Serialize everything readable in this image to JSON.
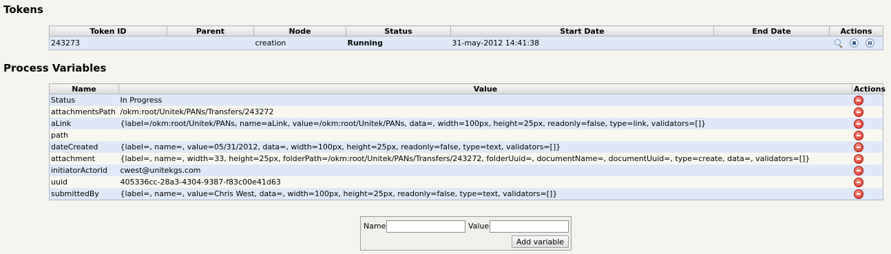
{
  "tokens": {
    "title": "Tokens",
    "columns": [
      "Token ID",
      "Parent",
      "Node",
      "Status",
      "Start Date",
      "End Date",
      "Actions"
    ],
    "rows": [
      {
        "token_id": "243273",
        "parent": "",
        "node": "creation",
        "status": "Running",
        "start_date": "31-may-2012 14:41:38",
        "end_date": "",
        "actions": [
          "view-icon",
          "stop-icon",
          "pause-icon"
        ]
      }
    ]
  },
  "variables": {
    "title": "Process Variables",
    "columns": [
      "Name",
      "Value",
      "Actions"
    ],
    "rows": [
      {
        "name": "Status",
        "value": "In Progress"
      },
      {
        "name": "attachmentsPath",
        "value": "/okm:root/Unitek/PANs/Transfers/243272"
      },
      {
        "name": "aLink",
        "value": "{label=/okm:root/Unitek/PANs, name=aLink, value=/okm:root/Unitek/PANs, data=, width=100px, height=25px, readonly=false, type=link, validators=[]}"
      },
      {
        "name": "path",
        "value": ""
      },
      {
        "name": "dateCreated",
        "value": "{label=, name=, value=05/31/2012, data=, width=100px, height=25px, readonly=false, type=text, validators=[]}"
      },
      {
        "name": "attachment",
        "value": "{label=, name=, width=33, height=25px, folderPath=/okm:root/Unitek/PANs/Transfers/243272, folderUuid=, documentName=, documentUuid=, type=create, data=, validators=[]}"
      },
      {
        "name": "initiatorActorId",
        "value": "cwest@unitekgs.com"
      },
      {
        "name": "uuid",
        "value": "405336cc-28a3-4304-9387-f83c00e41d63"
      },
      {
        "name": "submittedBy",
        "value": "{label=, name=, value=Chris West, data=, width=100px, height=25px, readonly=false, type=text, validators=[]}"
      }
    ],
    "row_action_icon": "delete-icon"
  },
  "add_form": {
    "name_label": "Name",
    "name_value": "",
    "value_label": "Value",
    "value_value": "",
    "button_label": "Add variable"
  }
}
